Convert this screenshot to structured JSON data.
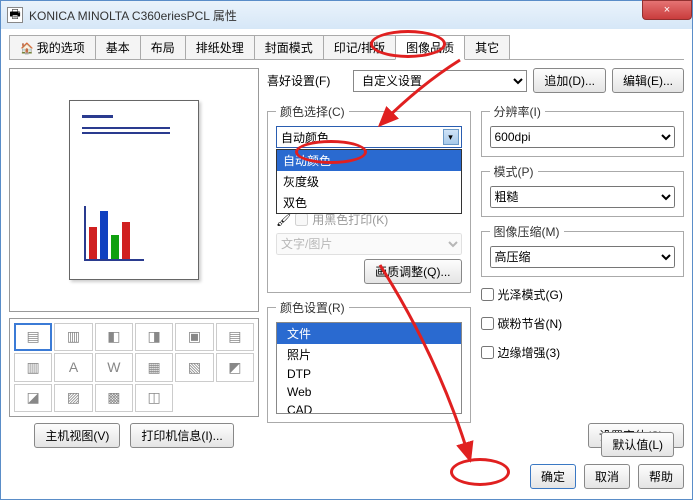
{
  "window": {
    "title": "KONICA MINOLTA C360eriesPCL 属性",
    "close": "×"
  },
  "tabs": [
    "我的选项",
    "基本",
    "布局",
    "排纸处理",
    "封面模式",
    "印记/排版",
    "图像品质",
    "其它"
  ],
  "active_tab_index": 6,
  "pref": {
    "label": "喜好设置(F)",
    "value": "自定义设置",
    "add": "追加(D)...",
    "edit": "编辑(E)..."
  },
  "color_select": {
    "legend": "颜色选择(C)",
    "value": "自动颜色",
    "options": [
      "自动颜色",
      "灰度级",
      "双色"
    ],
    "selected_index": 0,
    "black_print": "用黑色打印(K)",
    "text_image": "文字/图片",
    "quality_btn": "画质调整(Q)..."
  },
  "color_setting": {
    "legend": "颜色设置(R)",
    "options": [
      "文件",
      "照片",
      "DTP",
      "Web",
      "CAD"
    ],
    "selected_index": 0
  },
  "resolution": {
    "legend": "分辨率(I)",
    "value": "600dpi"
  },
  "mode": {
    "legend": "模式(P)",
    "value": "粗糙"
  },
  "compression": {
    "legend": "图像压缩(M)",
    "value": "高压缩"
  },
  "checks": {
    "gloss": "光泽模式(G)",
    "toner": "碳粉节省(N)",
    "edge": "边缘增强(3)"
  },
  "font_btn": "设置字体(S)...",
  "left_btns": {
    "main": "主机视图(V)",
    "printer": "打印机信息(I)..."
  },
  "bottom_btns": {
    "default": "默认值(L)",
    "ok": "确定",
    "cancel": "取消",
    "help": "帮助"
  }
}
